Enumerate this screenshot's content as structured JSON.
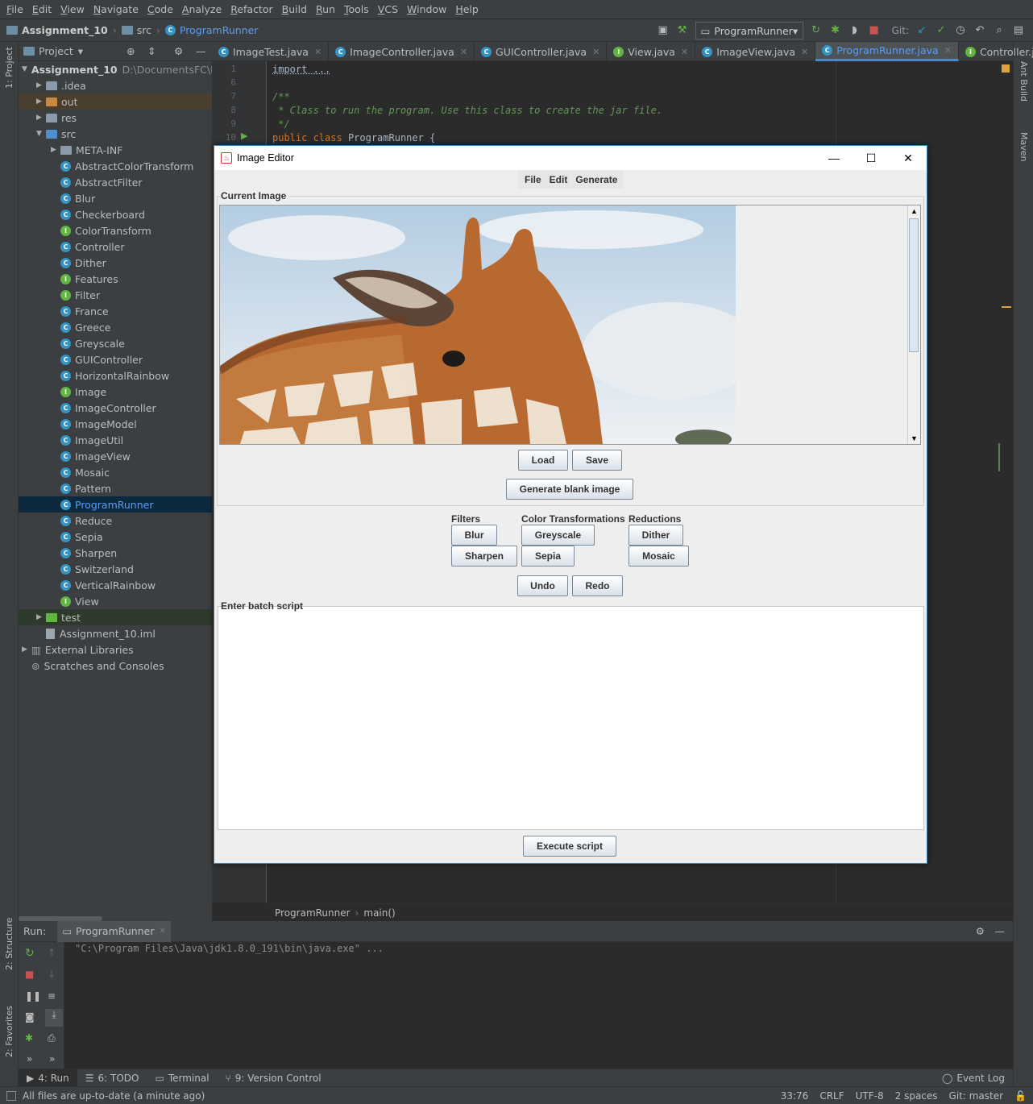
{
  "menu": [
    "File",
    "Edit",
    "View",
    "Navigate",
    "Code",
    "Analyze",
    "Refactor",
    "Build",
    "Run",
    "Tools",
    "VCS",
    "Window",
    "Help"
  ],
  "breadcrumb": {
    "project": "Assignment_10",
    "folder": "src",
    "file": "ProgramRunner"
  },
  "toolbar": {
    "run_config": "ProgramRunner",
    "git_label": "Git:"
  },
  "left_strip": {
    "project": "1: Project",
    "structure": "2: Structure",
    "favorites": "2: Favorites"
  },
  "right_strip": {
    "ant": "Ant Build",
    "maven": "Maven"
  },
  "project_panel": {
    "title": "Project",
    "root": "Assignment_10",
    "root_path": "D:\\DocumentsFC\\NE",
    "items": [
      ".idea",
      "out",
      "res",
      "src",
      "META-INF",
      "AbstractColorTransform",
      "AbstractFilter",
      "Blur",
      "Checkerboard",
      "ColorTransform",
      "Controller",
      "Dither",
      "Features",
      "Filter",
      "France",
      "Greece",
      "Greyscale",
      "GUIController",
      "HorizontalRainbow",
      "Image",
      "ImageController",
      "ImageModel",
      "ImageUtil",
      "ImageView",
      "Mosaic",
      "Pattern",
      "ProgramRunner",
      "Reduce",
      "Sepia",
      "Sharpen",
      "Switzerland",
      "VerticalRainbow",
      "View",
      "test",
      "Assignment_10.iml",
      "External Libraries",
      "Scratches and Consoles"
    ]
  },
  "editor_tabs": [
    "ImageTest.java",
    "ImageController.java",
    "GUIController.java",
    "View.java",
    "ImageView.java",
    "ProgramRunner.java",
    "Controller.java"
  ],
  "code": {
    "line1": "import ...",
    "line7": "/**",
    "line8": " * Class to run the program. Use this class to create the jar file.",
    "line9": " */",
    "line10_kw": "public class",
    "line10_name": "ProgramRunner {"
  },
  "line_numbers": [
    "1",
    "6",
    "7",
    "8",
    "9",
    "10"
  ],
  "editor_breadcrumb": {
    "cls": "ProgramRunner",
    "method": "main()"
  },
  "run_panel": {
    "label": "Run:",
    "tab": "ProgramRunner",
    "output": "\"C:\\Program Files\\Java\\jdk1.8.0_191\\bin\\java.exe\" ..."
  },
  "bottom_tabs": [
    "4: Run",
    "6: TODO",
    "Terminal",
    "9: Version Control"
  ],
  "event_log": "Event Log",
  "status": {
    "message": "All files are up-to-date (a minute ago)",
    "position": "33:76",
    "line_sep": "CRLF",
    "encoding": "UTF-8",
    "indent": "2 spaces",
    "git": "Git: master"
  },
  "dialog": {
    "title": "Image Editor",
    "menu": [
      "File",
      "Edit",
      "Generate"
    ],
    "current_image_label": "Current Image",
    "load": "Load",
    "save": "Save",
    "generate_blank": "Generate blank image",
    "filters_label": "Filters",
    "color_label": "Color Transformations",
    "reductions_label": "Reductions",
    "blur": "Blur",
    "sharpen": "Sharpen",
    "greyscale": "Greyscale",
    "sepia": "Sepia",
    "dither": "Dither",
    "mosaic": "Mosaic",
    "undo": "Undo",
    "redo": "Redo",
    "batch_label": "Enter batch script",
    "execute": "Execute script"
  },
  "colors": {
    "accent": "#4a88c7",
    "selection": "#0d293e",
    "class_icon": "#3592c4",
    "interface_icon": "#62b543",
    "keyword": "#cc7832",
    "comment": "#629755"
  }
}
